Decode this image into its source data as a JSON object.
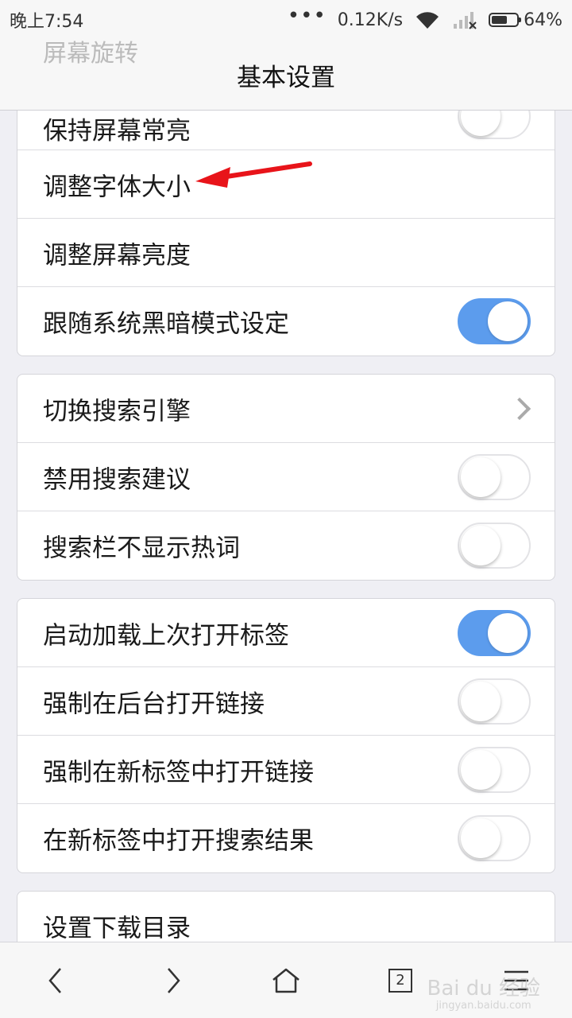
{
  "status_bar": {
    "time": "晚上7:54",
    "dots": "•••",
    "speed": "0.12K/s",
    "battery": "64%",
    "battery_level": 0.64
  },
  "header": {
    "title": "基本设置",
    "ghost_text": "屏幕旋转"
  },
  "groups": [
    {
      "items": [
        {
          "label": "保持屏幕常亮",
          "control": "toggle",
          "on": false
        },
        {
          "label": "调整字体大小",
          "control": "none"
        },
        {
          "label": "调整屏幕亮度",
          "control": "none"
        },
        {
          "label": "跟随系统黑暗模式设定",
          "control": "toggle",
          "on": true
        }
      ]
    },
    {
      "items": [
        {
          "label": "切换搜索引擎",
          "control": "chevron"
        },
        {
          "label": "禁用搜索建议",
          "control": "toggle",
          "on": false
        },
        {
          "label": "搜索栏不显示热词",
          "control": "toggle",
          "on": false
        }
      ]
    },
    {
      "items": [
        {
          "label": "启动加载上次打开标签",
          "control": "toggle",
          "on": true
        },
        {
          "label": "强制在后台打开链接",
          "control": "toggle",
          "on": false
        },
        {
          "label": "强制在新标签中打开链接",
          "control": "toggle",
          "on": false
        },
        {
          "label": "在新标签中打开搜索结果",
          "control": "toggle",
          "on": false
        }
      ]
    },
    {
      "items": [
        {
          "label": "设置下载目录",
          "control": "none"
        }
      ]
    }
  ],
  "bottom_nav": {
    "tab_count": "2"
  },
  "watermark": {
    "brand": "Bai du 经验",
    "url": "jingyan.baidu.com"
  },
  "colors": {
    "toggle_on": "#5c9ced",
    "annotation_arrow": "#e8141a"
  }
}
